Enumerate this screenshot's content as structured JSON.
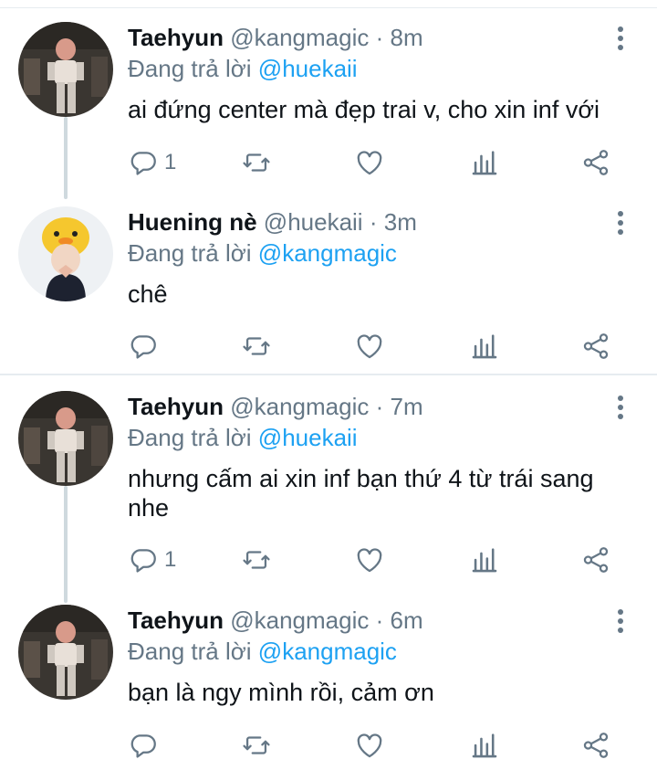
{
  "tweets": [
    {
      "name": "Taehyun",
      "handle": "@kangmagic",
      "dot": "·",
      "time": "8m",
      "reply_prefix": "Đang trả lời",
      "reply_to": "@huekaii",
      "text": "ai đứng center mà đẹp trai v, cho xin inf với",
      "reply_count": "1"
    },
    {
      "name": "Huening nè",
      "handle": "@huekaii",
      "dot": "·",
      "time": "3m",
      "reply_prefix": "Đang trả lời",
      "reply_to": "@kangmagic",
      "text": "chê",
      "reply_count": ""
    },
    {
      "name": "Taehyun",
      "handle": "@kangmagic",
      "dot": "·",
      "time": "7m",
      "reply_prefix": "Đang trả lời",
      "reply_to": "@huekaii",
      "text": "nhưng cấm ai xin inf bạn thứ 4 từ trái sang nhe",
      "reply_count": "1"
    },
    {
      "name": "Taehyun",
      "handle": "@kangmagic",
      "dot": "·",
      "time": "6m",
      "reply_prefix": "Đang trả lời",
      "reply_to": "@kangmagic",
      "text": "bạn là ngy mình rồi, cảm ơn",
      "reply_count": ""
    }
  ],
  "colors": {
    "name": "#0f1419",
    "secondary": "#657786",
    "mention": "#1da1f2",
    "divider": "#e6ecf0"
  },
  "icons": [
    "reply-icon",
    "retweet-icon",
    "like-icon",
    "analytics-icon",
    "share-icon",
    "more-icon"
  ]
}
